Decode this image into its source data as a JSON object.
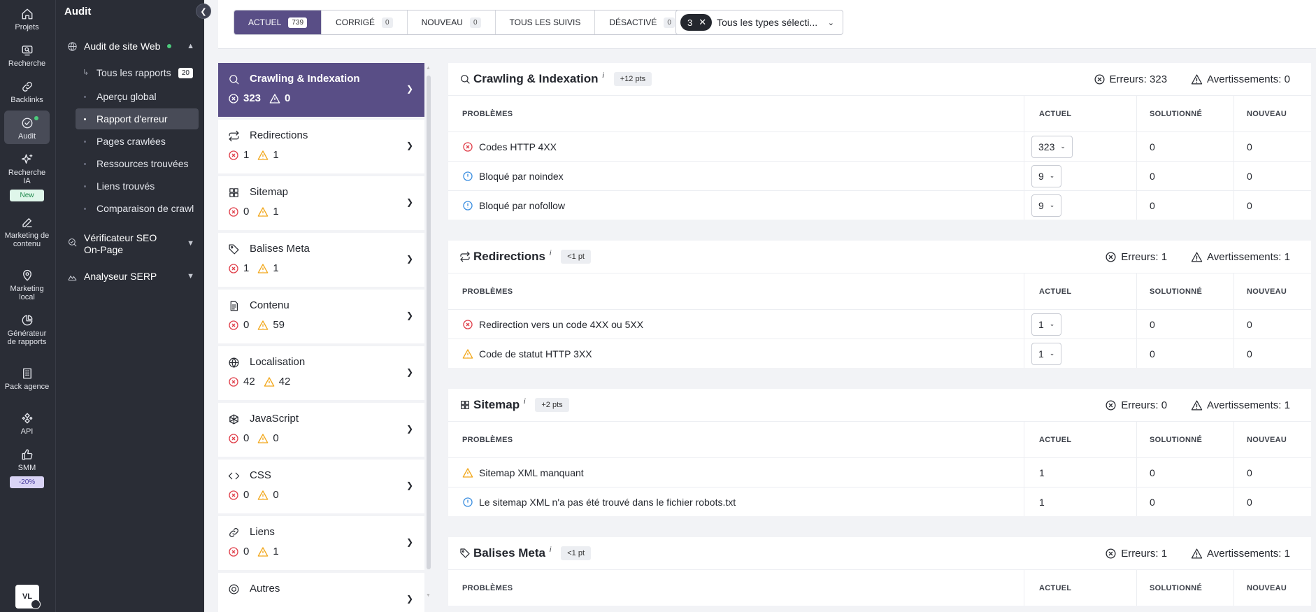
{
  "rail": [
    {
      "key": "projets",
      "label": "Projets",
      "icon": "home-icon"
    },
    {
      "key": "recherche",
      "label": "Recherche",
      "icon": "monitor-search-icon"
    },
    {
      "key": "backlinks",
      "label": "Backlinks",
      "icon": "link-icon"
    },
    {
      "key": "audit",
      "label": "Audit",
      "icon": "check-circle-icon"
    },
    {
      "key": "recherche-ia",
      "label": "Recherche IA",
      "icon": "sparkles-icon",
      "badge": "New"
    },
    {
      "key": "marketing-contenu",
      "label": "Marketing de contenu",
      "icon": "edit-icon"
    },
    {
      "key": "marketing-local",
      "label": "Marketing local",
      "icon": "map-pin-icon"
    },
    {
      "key": "generateur",
      "label": "Générateur de rapports",
      "icon": "pie-chart-icon"
    },
    {
      "key": "pack-agence",
      "label": "Pack agence",
      "icon": "building-icon"
    },
    {
      "key": "api",
      "label": "API",
      "icon": "api-icon"
    },
    {
      "key": "smm",
      "label": "SMM",
      "icon": "thumbs-up-icon",
      "badge": "-20%"
    }
  ],
  "colors": {
    "accent": "#594e86",
    "error": "#e0404b",
    "warning": "#f2a81d",
    "info": "#3d8fe0",
    "rail_bg": "#2a2d36",
    "new_badge": "#dff6ea",
    "promo_badge": "#d9d3f5"
  },
  "user": {
    "initials": "VL"
  },
  "sidebar": {
    "title": "Audit",
    "site_audit": {
      "label": "Audit de site Web",
      "icon": "globe-icon"
    },
    "items": [
      {
        "label": "Tous les rapports",
        "count": "20"
      },
      {
        "label": "Aperçu global"
      },
      {
        "label": "Rapport d'erreur"
      },
      {
        "label": "Pages crawlées"
      },
      {
        "label": "Ressources trouvées"
      },
      {
        "label": "Liens trouvés"
      },
      {
        "label": "Comparaison de crawl"
      }
    ],
    "onpage": {
      "label": "Vérificateur SEO On-Page",
      "icon": "search-check-icon"
    },
    "serp": {
      "label": "Analyseur SERP",
      "icon": "chart-mountain-icon"
    }
  },
  "status_tabs": [
    {
      "label": "ACTUEL",
      "count": "739"
    },
    {
      "label": "CORRIGÉ",
      "count": "0"
    },
    {
      "label": "NOUVEAU",
      "count": "0"
    },
    {
      "label": "TOUS LES SUIVIS"
    },
    {
      "label": "DÉSACTIVÉ",
      "count": "0"
    }
  ],
  "type_filter": {
    "count": "3",
    "label": "Tous les types sélecti..."
  },
  "categories": [
    {
      "name": "Crawling & Indexation",
      "errors": "323",
      "warnings": "0",
      "icon": "search-icon"
    },
    {
      "name": "Redirections",
      "errors": "1",
      "warnings": "1",
      "icon": "repeat-icon"
    },
    {
      "name": "Sitemap",
      "errors": "0",
      "warnings": "1",
      "icon": "grid-icon"
    },
    {
      "name": "Balises Meta",
      "errors": "1",
      "warnings": "1",
      "icon": "tag-icon"
    },
    {
      "name": "Contenu",
      "errors": "0",
      "warnings": "59",
      "icon": "document-icon"
    },
    {
      "name": "Localisation",
      "errors": "42",
      "warnings": "42",
      "icon": "globe-icon"
    },
    {
      "name": "JavaScript",
      "errors": "0",
      "warnings": "0",
      "icon": "js-icon"
    },
    {
      "name": "CSS",
      "errors": "0",
      "warnings": "0",
      "icon": "code-icon"
    },
    {
      "name": "Liens",
      "errors": "0",
      "warnings": "1",
      "icon": "link-icon"
    },
    {
      "name": "Autres",
      "icon": "target-icon"
    }
  ],
  "table_headers": {
    "problems": "PROBLÈMES",
    "current": "ACTUEL",
    "solved": "SOLUTIONNÉ",
    "new": "NOUVEAU"
  },
  "labels": {
    "errors": "Erreurs:",
    "warnings": "Avertissements:",
    "info_mark": "i"
  },
  "sections": [
    {
      "title": "Crawling & Indexation",
      "pts": "+12 pts",
      "errors": "323",
      "warnings": "0",
      "icon": "search-icon",
      "rows": [
        {
          "type": "error",
          "problem": "Codes HTTP 4XX",
          "current": "323",
          "solved": "0",
          "new": "0",
          "dropdown": true
        },
        {
          "type": "info",
          "problem": "Bloqué par noindex",
          "current": "9",
          "solved": "0",
          "new": "0",
          "dropdown": true
        },
        {
          "type": "info",
          "problem": "Bloqué par nofollow",
          "current": "9",
          "solved": "0",
          "new": "0",
          "dropdown": true
        }
      ]
    },
    {
      "title": "Redirections",
      "pts": "<1 pt",
      "errors": "1",
      "warnings": "1",
      "icon": "repeat-icon",
      "rows": [
        {
          "type": "error",
          "problem": "Redirection vers un code 4XX ou 5XX",
          "current": "1",
          "solved": "0",
          "new": "0",
          "dropdown": true
        },
        {
          "type": "warning",
          "problem": "Code de statut HTTP 3XX",
          "current": "1",
          "solved": "0",
          "new": "0",
          "dropdown": true
        }
      ]
    },
    {
      "title": "Sitemap",
      "pts": "+2 pts",
      "errors": "0",
      "warnings": "1",
      "icon": "grid-icon",
      "rows": [
        {
          "type": "warning",
          "problem": "Sitemap XML manquant",
          "current": "1",
          "solved": "0",
          "new": "0",
          "dropdown": false
        },
        {
          "type": "info",
          "problem": "Le sitemap XML n'a pas été trouvé dans le fichier robots.txt",
          "current": "1",
          "solved": "0",
          "new": "0",
          "dropdown": false
        }
      ]
    },
    {
      "title": "Balises Meta",
      "pts": "<1 pt",
      "errors": "1",
      "warnings": "1",
      "icon": "tag-icon",
      "rows": []
    }
  ]
}
